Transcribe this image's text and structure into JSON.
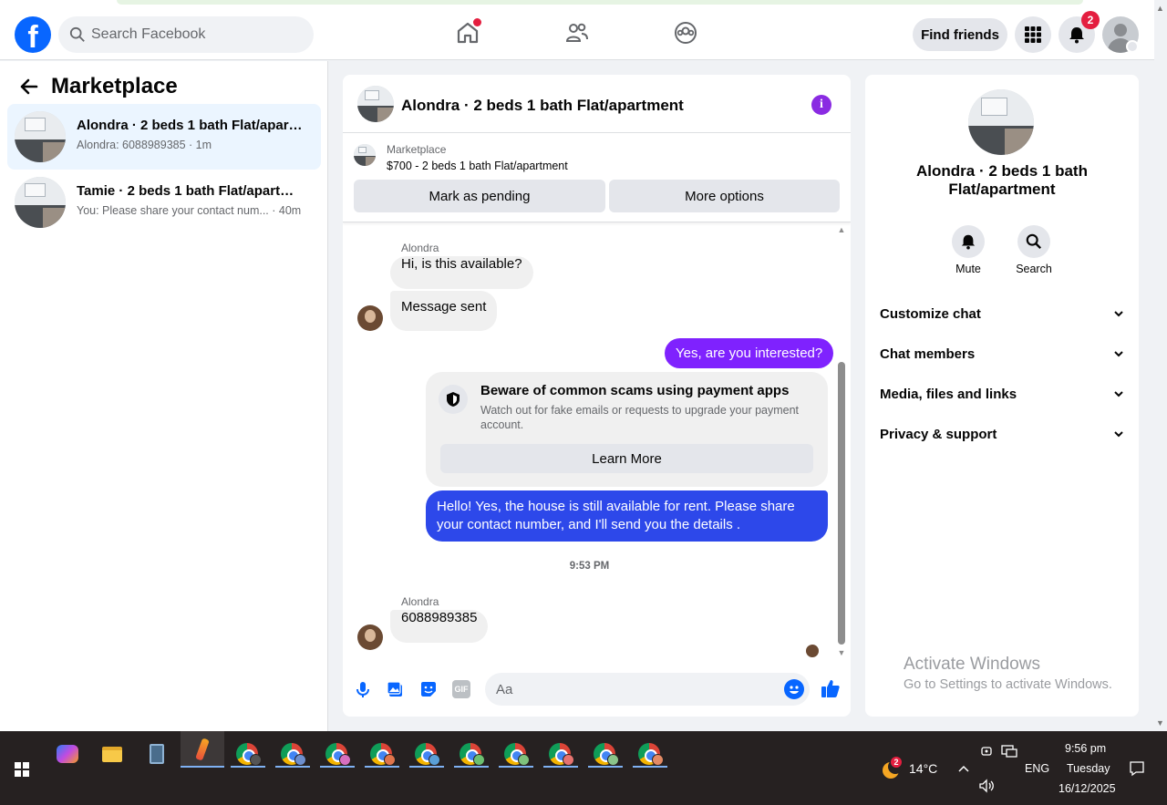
{
  "topbar": {
    "logo_letter": "f",
    "search_placeholder": "Search Facebook",
    "find_friends": "Find friends",
    "notification_count": "2"
  },
  "left": {
    "title": "Marketplace",
    "conversations": [
      {
        "title": "Alondra · 2 beds 1 bath Flat/apart...",
        "preview": "Alondra: 6088989385 · 1m"
      },
      {
        "title": "Tamie · 2 beds 1 bath Flat/apartme...",
        "preview": "You: Please share your contact num... · 40m"
      }
    ]
  },
  "chat": {
    "title": "Alondra · 2 beds 1 bath Flat/apartment",
    "listing_source": "Marketplace",
    "listing_price": "$700 - 2 beds 1 bath Flat/apartment",
    "mark_pending": "Mark as pending",
    "more_options": "More options",
    "messages": {
      "sender1": "Alondra",
      "in1": "Hi, is this available?",
      "in2": "Message sent",
      "out1": "Yes, are you interested?",
      "warn_title": "Beware of common scams using payment apps",
      "warn_body": "Watch out for fake emails or requests to upgrade your payment account.",
      "learn_more": "Learn More",
      "out2": "Hello! Yes, the house is still available for rent. Please share your contact number, and I'll send you the details .",
      "time": "9:53 PM",
      "sender2": "Alondra",
      "in3": "6088989385"
    },
    "composer_placeholder": "Aa",
    "gif_label": "GIF",
    "colors": {
      "purple": "#7f22fe",
      "blue": "#2d48ea",
      "accent": "#0866ff"
    }
  },
  "right": {
    "title": "Alondra · 2 beds 1 bath Flat/apartment",
    "mute": "Mute",
    "search": "Search",
    "sections": [
      "Customize chat",
      "Chat members",
      "Media, files and links",
      "Privacy & support"
    ],
    "watermark_title": "Activate Windows",
    "watermark_sub": "Go to Settings to activate Windows."
  },
  "taskbar": {
    "weather_badge": "2",
    "temperature": "14°C",
    "language": "ENG",
    "time": "9:56 pm",
    "day": "Tuesday",
    "date": "16/12/2025"
  }
}
